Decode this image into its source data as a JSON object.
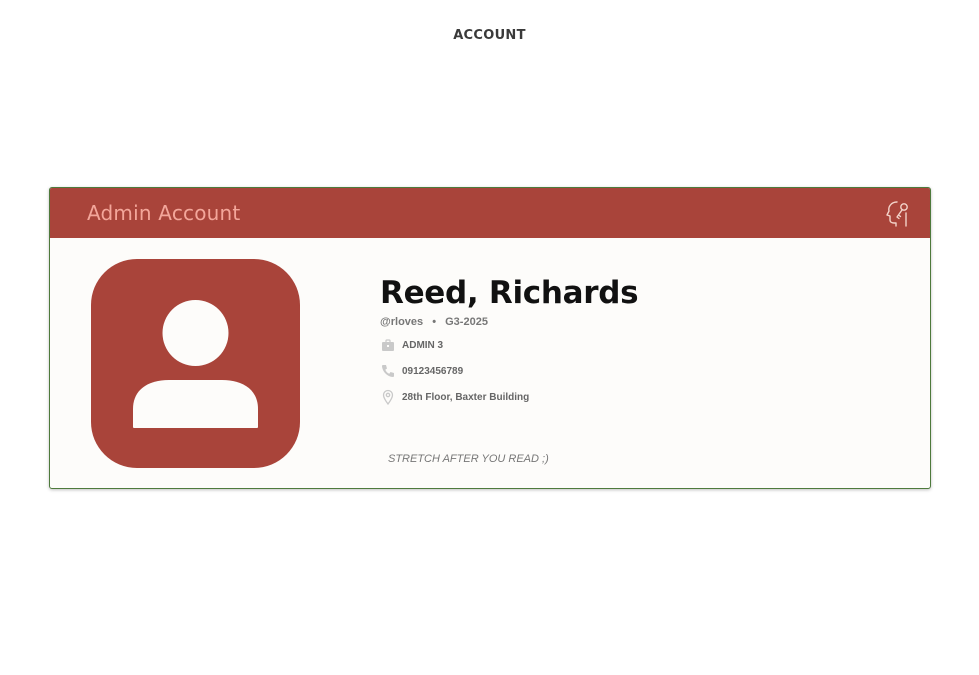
{
  "page": {
    "title": "ACCOUNT"
  },
  "card": {
    "header_title": "Admin Account",
    "settings_icon": "user-settings-icon",
    "accent_color": "#a9443a",
    "header_text_color": "#f3a69a"
  },
  "profile": {
    "avatar_icon": "user-avatar-icon",
    "name": "Reed, Richards",
    "username": "@rloves",
    "group": "G3-2025",
    "role": "ADMIN 3",
    "role_icon": "briefcase-icon",
    "phone": "09123456789",
    "phone_icon": "phone-icon",
    "address": "28th Floor, Baxter Building",
    "address_icon": "location-pin-icon",
    "bio": "STRETCH AFTER YOU READ ;)"
  }
}
